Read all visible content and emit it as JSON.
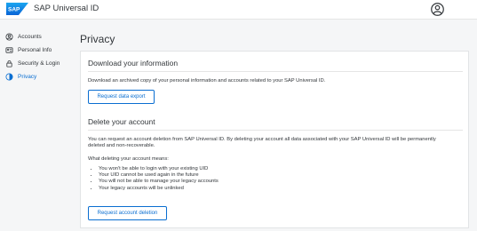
{
  "header": {
    "logo_text": "SAP",
    "app_title": "SAP Universal ID",
    "user_icon": "user-circle-icon"
  },
  "sidebar": {
    "items": [
      {
        "label": "Accounts",
        "icon": "accounts-icon"
      },
      {
        "label": "Personal Info",
        "icon": "personal-info-icon"
      },
      {
        "label": "Security & Login",
        "icon": "lock-icon"
      },
      {
        "label": "Privacy",
        "icon": "privacy-icon",
        "active": true
      }
    ]
  },
  "main": {
    "page_title": "Privacy",
    "download": {
      "title": "Download your information",
      "description": "Download an archived copy of your personal information and accounts related to your SAP Universal ID.",
      "button_label": "Request data export"
    },
    "delete": {
      "title": "Delete your account",
      "description": "You can request an account deletion from SAP Universal ID. By deleting your account all data associated with your SAP Universal ID will be permanently deleted and non-recoverable.",
      "means_label": "What deleting your account means:",
      "bullets": [
        "You won't be able to login with your existing UID",
        "Your UID cannot be used again in the future",
        "You will not be able to manage your legacy accounts",
        "Your legacy accounts will be unlinked"
      ],
      "button_label": "Request account deletion"
    }
  },
  "colors": {
    "accent": "#0a6ed1",
    "text": "#32363a",
    "background": "#f5f6f7",
    "logo_blue": "#0070f2"
  }
}
